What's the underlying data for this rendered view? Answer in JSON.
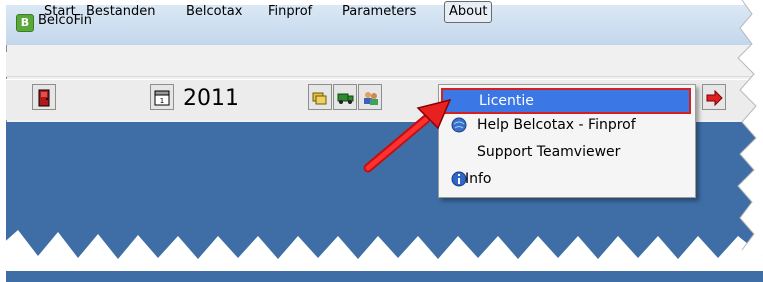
{
  "window": {
    "title": "BelcoFin",
    "app_icon_letter": "B"
  },
  "menubar": {
    "items": [
      {
        "label": "Start"
      },
      {
        "label": "Bestanden"
      },
      {
        "label": "Belcotax"
      },
      {
        "label": "Finprof"
      },
      {
        "label": "Parameters"
      },
      {
        "label": "About"
      }
    ]
  },
  "toolbar": {
    "year": "2011"
  },
  "about_menu": {
    "items": [
      {
        "label": "Licentie",
        "icon": "none"
      },
      {
        "label": "Help Belcotax - Finprof",
        "icon": "help-globe-icon"
      },
      {
        "label": "Support Teamviewer",
        "icon": "none"
      },
      {
        "label": "Info",
        "icon": "info-icon"
      }
    ]
  },
  "colors": {
    "workarea": "#3f6ea6",
    "highlight": "#3b78e6",
    "annotation_arrow": "#e02020"
  }
}
